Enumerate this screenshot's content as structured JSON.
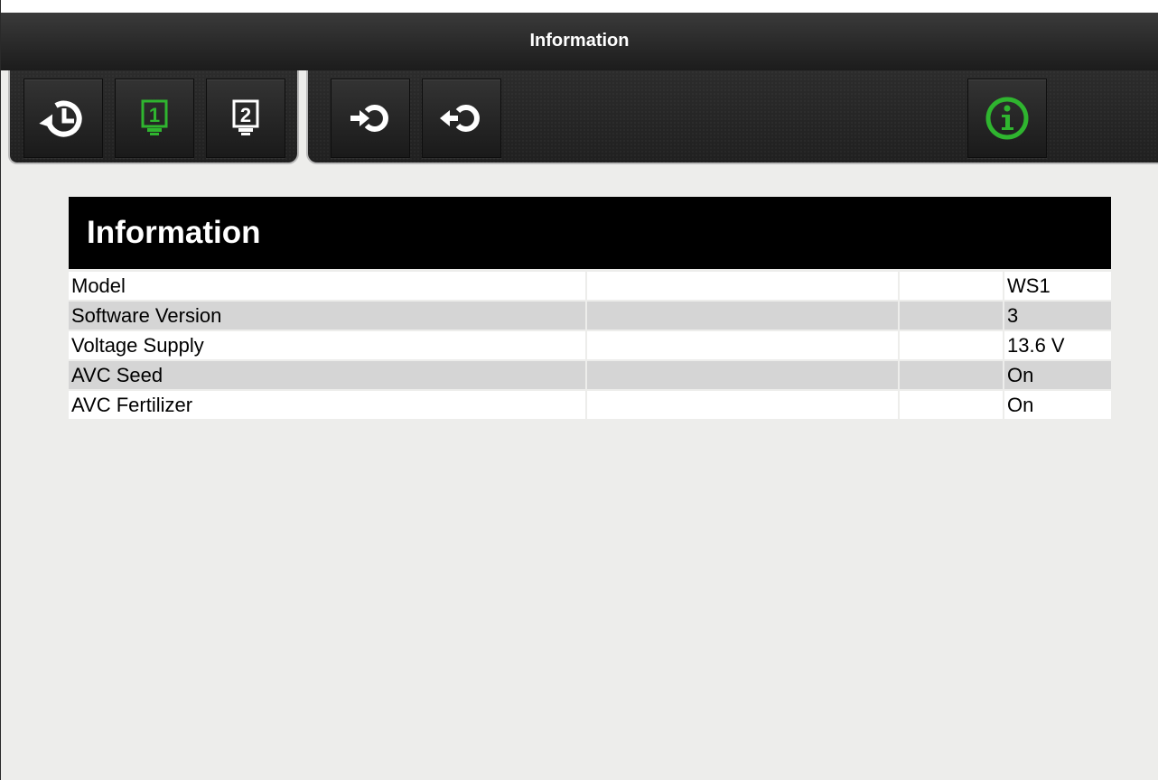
{
  "window": {
    "title": "Information"
  },
  "toolbar": {
    "buttons": [
      {
        "name": "history",
        "icon": "history-icon",
        "active": false
      },
      {
        "name": "screen-1",
        "icon": "screen-1-icon",
        "label": "1",
        "active": true
      },
      {
        "name": "screen-2",
        "icon": "screen-2-icon",
        "label": "2",
        "active": false
      },
      {
        "name": "rotate-in",
        "icon": "arrow-into-circle-icon",
        "active": false
      },
      {
        "name": "rotate-out",
        "icon": "arrow-out-of-circle-icon",
        "active": false
      },
      {
        "name": "information",
        "icon": "info-icon",
        "active": true
      }
    ]
  },
  "panel": {
    "title": "Information",
    "rows": [
      {
        "label": "Model",
        "value": "WS1"
      },
      {
        "label": "Software Version",
        "value": "3"
      },
      {
        "label": "Voltage Supply",
        "value": "13.6 V"
      },
      {
        "label": "AVC Seed",
        "value": "On"
      },
      {
        "label": "AVC Fertilizer",
        "value": "On"
      }
    ]
  },
  "colors": {
    "accent_green": "#2fb52f",
    "header_black": "#000000",
    "row_even": "#d5d5d5",
    "row_odd": "#ffffff",
    "background": "#ededeb"
  }
}
